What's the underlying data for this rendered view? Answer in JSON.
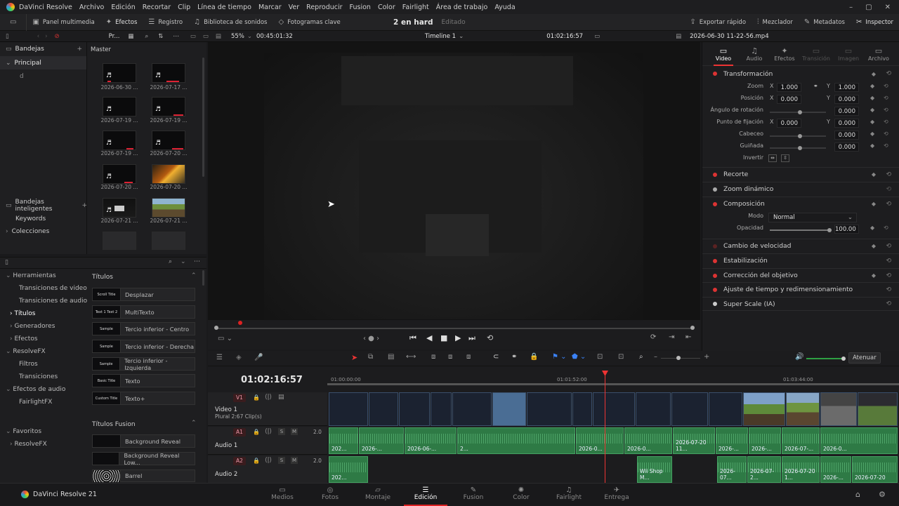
{
  "menubar": {
    "app": "DaVinci Resolve",
    "items": [
      "Archivo",
      "Edición",
      "Recortar",
      "Clip",
      "Línea de tiempo",
      "Marcar",
      "Ver",
      "Reproducir",
      "Fusion",
      "Color",
      "Fairlight",
      "Área de trabajo",
      "Ayuda"
    ]
  },
  "toolbar": {
    "media_pool": "Panel multimedia",
    "effects": "Efectos",
    "index": "Registro",
    "sound_library": "Biblioteca de sonidos",
    "keyframes": "Fotogramas clave",
    "quick_export": "Exportar rápido",
    "mixer": "Mezclador",
    "metadata": "Metadatos",
    "inspector": "Inspector"
  },
  "project": {
    "title": "2 en hard",
    "status": "Editado"
  },
  "viewerbar": {
    "sort": "Pr...",
    "zoom": "55%",
    "timecode_dur": "00:45:01:32",
    "timeline": "Timeline 1",
    "timecode": "01:02:16:57",
    "clip_name": "2026-06-30 11-22-56.mp4"
  },
  "bins": {
    "title": "Bandejas",
    "master": "Master",
    "main": "Principal",
    "sub": "d",
    "smart": "Bandejas inteligentes",
    "keywords": "Keywords",
    "collections": "Colecciones"
  },
  "clips": [
    {
      "name": "2026-06-30 ..."
    },
    {
      "name": "2026-07-17 ..."
    },
    {
      "name": "2026-07-19 ..."
    },
    {
      "name": "2026-07-19 ..."
    },
    {
      "name": "2026-07-19 ..."
    },
    {
      "name": "2026-07-20 ..."
    },
    {
      "name": "2026-07-20 ..."
    },
    {
      "name": "2026-07-20 ..."
    },
    {
      "name": "2026-07-21 ..."
    },
    {
      "name": "2026-07-21 ..."
    }
  ],
  "effects_tree": {
    "tools": "Herramientas",
    "video_trans": "Transiciones de video",
    "audio_trans": "Transiciones de audio",
    "titles": "Títulos",
    "generators": "Generadores",
    "effects": "Efectos",
    "resolvefx": "ResolveFX",
    "filters": "Filtros",
    "transitions": "Transiciones",
    "audio_fx": "Efectos de audio",
    "fairlightfx": "FairlightFX",
    "favorites": "Favoritos",
    "fav_resolvefx": "ResolveFX"
  },
  "titles": {
    "header": "Títulos",
    "items": [
      {
        "thumb": "Scroll Title",
        "name": "Desplazar"
      },
      {
        "thumb": "Text 1 Text 2",
        "name": "MultiTexto"
      },
      {
        "thumb": "Sample",
        "name": "Tercio inferior - Centro"
      },
      {
        "thumb": "Sample",
        "name": "Tercio inferior - Derecha"
      },
      {
        "thumb": "Sample",
        "name": "Tercio inferior - Izquierda"
      },
      {
        "thumb": "Basic Title",
        "name": "Texto"
      },
      {
        "thumb": "Custom Title",
        "name": "Texto+"
      }
    ],
    "fusion_header": "Títulos Fusion",
    "fusion_items": [
      {
        "name": "Background Reveal"
      },
      {
        "name": "Background Reveal Low..."
      },
      {
        "name": "Barrel"
      }
    ]
  },
  "inspector": {
    "tabs": [
      "Video",
      "Audio",
      "Efectos",
      "Transición",
      "Imagen",
      "Archivo"
    ],
    "transform": "Transformación",
    "zoom_label": "Zoom",
    "zoom_x": "1.000",
    "zoom_y": "1.000",
    "pos_label": "Posición",
    "pos_x": "0.000",
    "pos_y": "0.000",
    "rot_label": "Ángulo de rotación",
    "rot": "0.000",
    "anchor_label": "Punto de fijación",
    "anchor_x": "0.000",
    "anchor_y": "0.000",
    "pitch_label": "Cabeceo",
    "pitch": "0.000",
    "yaw_label": "Guiñada",
    "yaw": "0.000",
    "flip_label": "Invertir",
    "crop": "Recorte",
    "dyn_zoom": "Zoom dinámico",
    "composite": "Composición",
    "mode_label": "Modo",
    "mode": "Normal",
    "opacity_label": "Opacidad",
    "opacity": "100.00",
    "speed": "Cambio de velocidad",
    "stab": "Estabilización",
    "lens": "Corrección del objetivo",
    "retime": "Ajuste de tiempo y redimensionamiento",
    "superscale": "Super Scale (IA)"
  },
  "timeline": {
    "timecode": "01:02:16:57",
    "ruler": [
      "01:00:00:00",
      "01:01:52:00",
      "01:03:44:00"
    ],
    "v1_tag": "V1",
    "v1_name": "Video 1",
    "v1_info": "Plural 2:67 Clip(s)",
    "a1_tag": "A1",
    "a1_name": "Audio 1",
    "a2_tag": "A2",
    "a2_name": "Audio 2",
    "level": "2.0",
    "solo": "S",
    "mute": "M",
    "attenuate": "Atenuar",
    "a1_clips": [
      "202...",
      "2026-...",
      "2026-06-...",
      "2...",
      "2026-0...",
      "2026-0...",
      "2026-07-20 11...",
      "2026-...",
      "2026-...",
      "2026-07-...",
      "2026-0..."
    ],
    "a2_clips": [
      "202...",
      "Wii Shop M...",
      "2026-07...",
      "2026-07-2...",
      "2026-07-20 1...",
      "2026-...",
      "2026-07-20"
    ]
  },
  "pages": [
    "Medios",
    "Fotos",
    "Montaje",
    "Edición",
    "Fusion",
    "Color",
    "Fairlight",
    "Entrega"
  ],
  "footer": {
    "brand": "DaVinci Resolve 21"
  }
}
